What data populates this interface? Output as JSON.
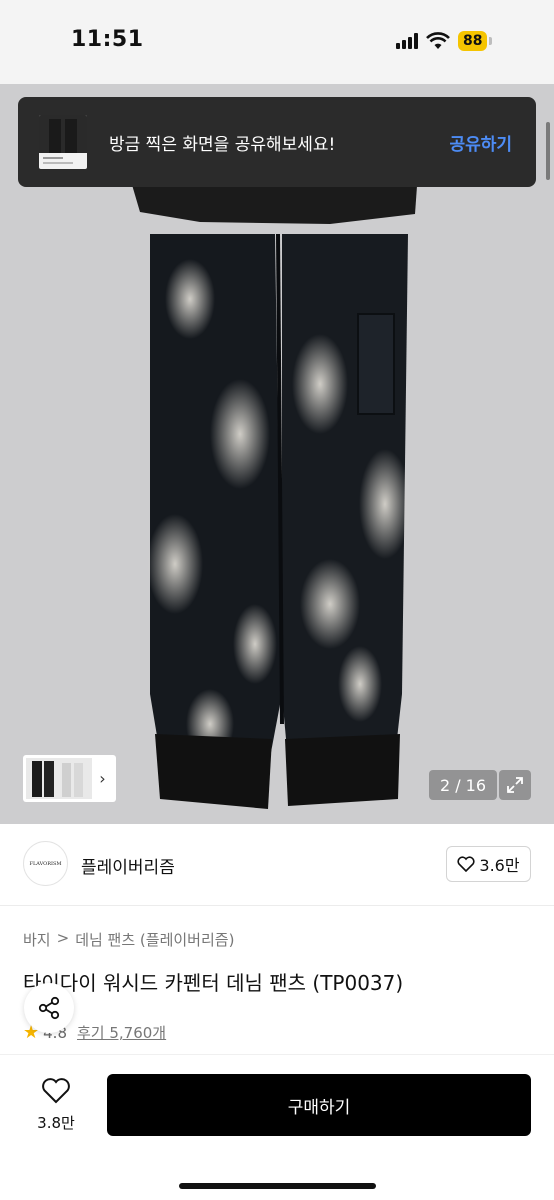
{
  "status_bar": {
    "time": "11:51",
    "battery": "88"
  },
  "toast": {
    "message": "방금 찍은 화면을 공유해보세요!",
    "action_label": "공유하기"
  },
  "gallery": {
    "counter": "2 / 16"
  },
  "brand": {
    "logo_text": "FLAVORISM",
    "name": "플레이버리즘",
    "likes": "3.6만"
  },
  "breadcrumb": {
    "category": "바지",
    "separator": ">",
    "subcategory": "데님 팬츠 (플레이버리즘)"
  },
  "product": {
    "title": "타이다이 워시드 카펜터 데님 팬츠 (TP0037)",
    "rating": "4.8",
    "reviews_label": "후기 5,760개"
  },
  "bottom_bar": {
    "wish_count": "3.8만",
    "buy_label": "구매하기"
  },
  "colors": {
    "accent_blue": "#4d8cf5",
    "star": "#f5b400",
    "battery": "#f5c400"
  },
  "icons": [
    "wifi-icon",
    "heart-icon",
    "share-icon",
    "star-icon",
    "expand-icon",
    "chevron-right-icon"
  ]
}
